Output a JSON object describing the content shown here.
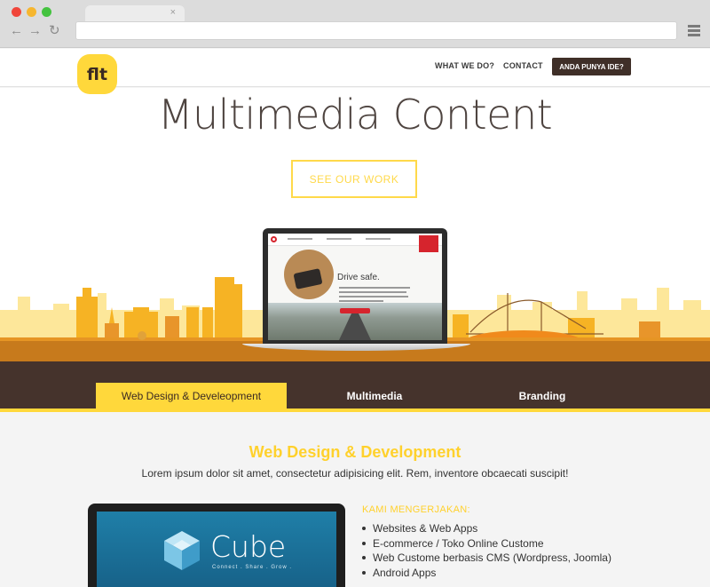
{
  "browser": {
    "tab_close": "×",
    "nav_back": "←",
    "nav_forward": "→",
    "nav_reload": "↻"
  },
  "site": {
    "logo_text": "flt",
    "nav": {
      "what": "WHAT WE DO?",
      "contact": "CONTACT",
      "cta": "ANDA PUNYA IDE?"
    }
  },
  "hero": {
    "title": "Multimedia Content",
    "cta": "SEE OUR WORK",
    "laptop_heading": "Drive safe."
  },
  "tabs": [
    {
      "label": "Web Design & Develeopment",
      "active": true
    },
    {
      "label": "Multimedia",
      "active": false
    },
    {
      "label": "Branding",
      "active": false
    }
  ],
  "section": {
    "title": "Web Design & Development",
    "description": "Lorem ipsum dolor sit amet, consectetur adipisicing elit. Rem, inventore obcaecati suscipit!",
    "monitor_brand": "Cube",
    "monitor_tagline": "Connect . Share . Grow .",
    "list_heading": "KAMI MENGERJAKAN:",
    "list_items": [
      "Websites & Web Apps",
      "E-commerce / Toko Online Custome",
      "Web Custome berbasis CMS (Wordpress, Joomla)",
      "Android Apps"
    ]
  },
  "colors": {
    "accent_yellow": "#ffd83b",
    "dark_brown": "#45332c",
    "skyline_orange": "#f0a020"
  },
  "icons": [
    "tab-close-icon",
    "back-arrow-icon",
    "forward-arrow-icon",
    "reload-icon",
    "hamburger-menu-icon",
    "cube-icon"
  ]
}
